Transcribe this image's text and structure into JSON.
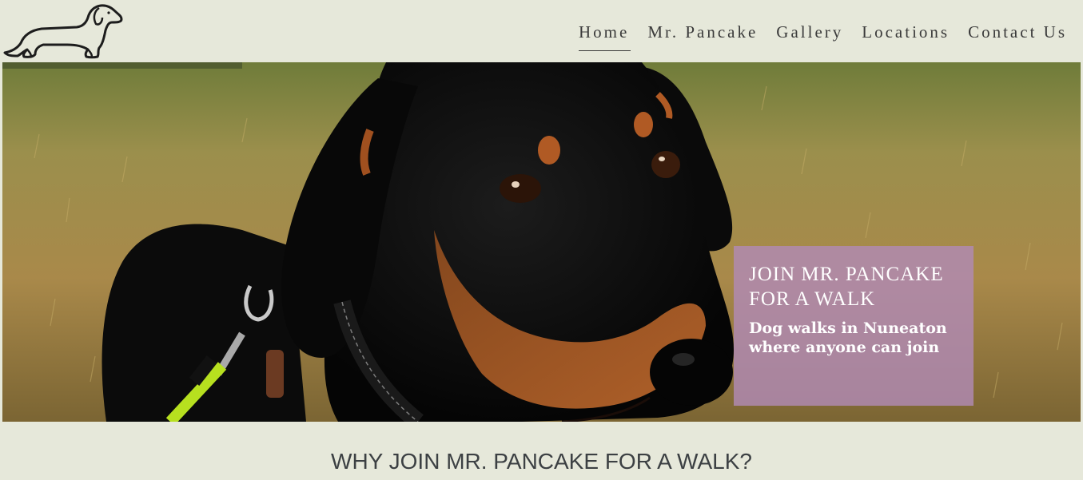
{
  "header": {
    "logo_icon": "dachshund-outline-icon",
    "nav": [
      {
        "label": "Home",
        "active": true
      },
      {
        "label": "Mr. Pancake",
        "active": false
      },
      {
        "label": "Gallery",
        "active": false
      },
      {
        "label": "Locations",
        "active": false
      },
      {
        "label": "Contact Us",
        "active": false
      }
    ]
  },
  "hero": {
    "image": "dachshund-portrait-photo",
    "callout": {
      "title": "JOIN MR. PANCAKE FOR A WALK",
      "subtitle": "Dog walks in Nuneaton where anyone can join",
      "background": "#b18ab4"
    }
  },
  "main": {
    "section_heading": "WHY JOIN MR. PANCAKE FOR A WALK?"
  },
  "colors": {
    "page_background": "#e6e8da",
    "nav_text": "#3a3a3a",
    "heading_text": "#3c4043"
  }
}
